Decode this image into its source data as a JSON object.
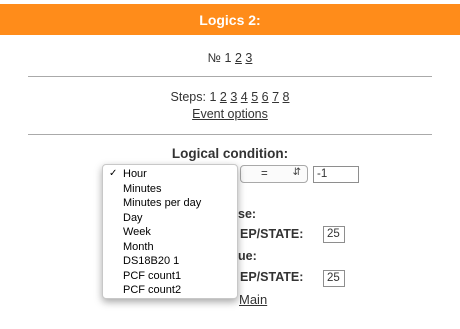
{
  "header": {
    "title": "Logics 2:"
  },
  "logic_nav": {
    "prefix": "№ 1",
    "links": [
      "2",
      "3"
    ]
  },
  "steps_nav": {
    "prefix": "Steps: 1",
    "links": [
      "2",
      "3",
      "4",
      "5",
      "6",
      "7",
      "8"
    ],
    "event_options": "Event options"
  },
  "condition": {
    "title": "Logical condition:",
    "operator": "=",
    "value": "-1"
  },
  "dropdown": {
    "selected": "Hour",
    "options": [
      "Hour",
      "Minutes",
      "Minutes per day",
      "Day",
      "Week",
      "Month",
      "DS18B20 1",
      "PCF count1",
      "PCF count2"
    ]
  },
  "false_branch": {
    "heading_fragment": "se:",
    "label_fragment": "EP/STATE:",
    "value": "25"
  },
  "true_branch": {
    "heading_fragment": "ue:",
    "label_fragment": "EP/STATE:",
    "value": "25"
  },
  "footer": {
    "main_link": "Main"
  },
  "colors": {
    "header_bg": "#ff8c1a",
    "header_text": "#ffffff"
  }
}
